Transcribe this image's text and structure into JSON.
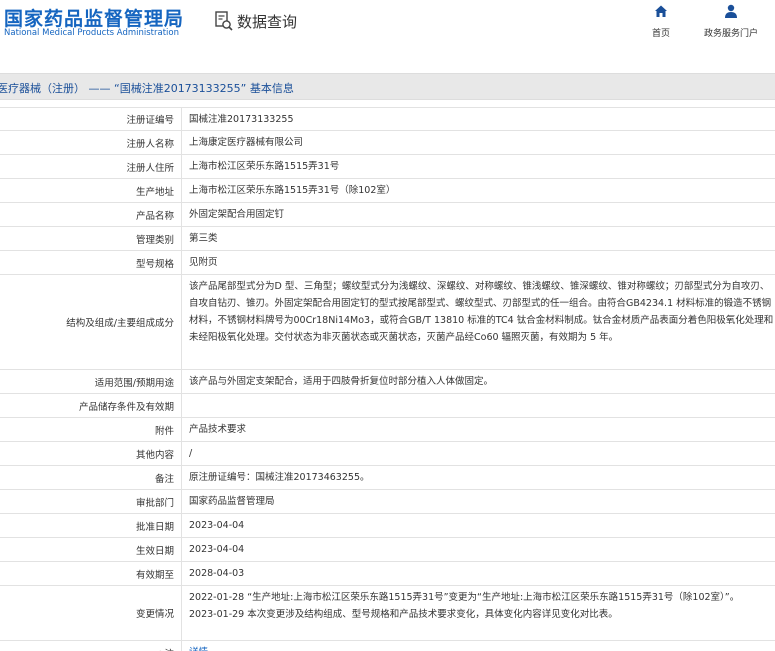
{
  "header": {
    "logo_cn": "国家药品监督管理局",
    "logo_en": "National Medical Products Administration",
    "query_label": "数据查询",
    "nav": [
      {
        "label": "首页",
        "icon": "home-icon"
      },
      {
        "label": "政务服务门户",
        "icon": "user-icon"
      }
    ]
  },
  "title_bar": {
    "text": "医疗器械（注册） —— “国械注准20173133255” 基本信息"
  },
  "rows": [
    {
      "label": "注册证编号",
      "value": "国械注准20173133255"
    },
    {
      "label": "注册人名称",
      "value": "上海康定医疗器械有限公司"
    },
    {
      "label": "注册人住所",
      "value": "上海市松江区荣乐东路1515弄31号"
    },
    {
      "label": "生产地址",
      "value": "上海市松江区荣乐东路1515弄31号（除102室）"
    },
    {
      "label": "产品名称",
      "value": "外固定架配合用固定钉"
    },
    {
      "label": "管理类别",
      "value": "第三类"
    },
    {
      "label": "型号规格",
      "value": "见附页"
    },
    {
      "label": "结构及组成/主要组成成分",
      "value": "该产品尾部型式分为D 型、三角型；螺纹型式分为浅螺纹、深螺纹、对称螺纹、锥浅螺纹、锥深螺纹、锥对称螺纹；刃部型式分为自攻刃、自攻自钻刃、锥刃。外固定架配合用固定钉的型式按尾部型式、螺纹型式、刃部型式的任一组合。由符合GB4234.1 材料标准的锻造不锈钢材料，不锈钢材料牌号为00Cr18Ni14Mo3，或符合GB/T 13810 标准的TC4 钛合金材料制成。钛合金材质产品表面分着色阳极氧化处理和未经阳极氧化处理。交付状态为非灭菌状态或灭菌状态，灭菌产品经Co60 辐照灭菌，有效期为 5 年。"
    },
    {
      "label": "适用范围/预期用途",
      "value": "该产品与外固定支架配合，适用于四肢骨折复位时部分植入人体做固定。"
    },
    {
      "label": "产品储存条件及有效期",
      "value": ""
    },
    {
      "label": "附件",
      "value": "产品技术要求"
    },
    {
      "label": "其他内容",
      "value": "/"
    },
    {
      "label": "备注",
      "value": "原注册证编号：国械注准20173463255。"
    },
    {
      "label": "审批部门",
      "value": "国家药品监督管理局"
    },
    {
      "label": "批准日期",
      "value": "2023-04-04"
    },
    {
      "label": "生效日期",
      "value": "2023-04-04"
    },
    {
      "label": "有效期至",
      "value": "2028-04-03"
    },
    {
      "label": "变更情况",
      "value": "2022-01-28 “生产地址:上海市松江区荣乐东路1515弄31号”变更为“生产地址:上海市松江区荣乐东路1515弄31号（除102室）”。\n2023-01-29 本次变更涉及结构组成、型号规格和产品技术要求变化，具体变化内容详见变化对比表。"
    },
    {
      "label": "●注",
      "value": "详情"
    }
  ],
  "colors": {
    "brand": "#1565c0",
    "title_bar_bg": "#e8e8e8",
    "border": "#e2e2e2"
  }
}
